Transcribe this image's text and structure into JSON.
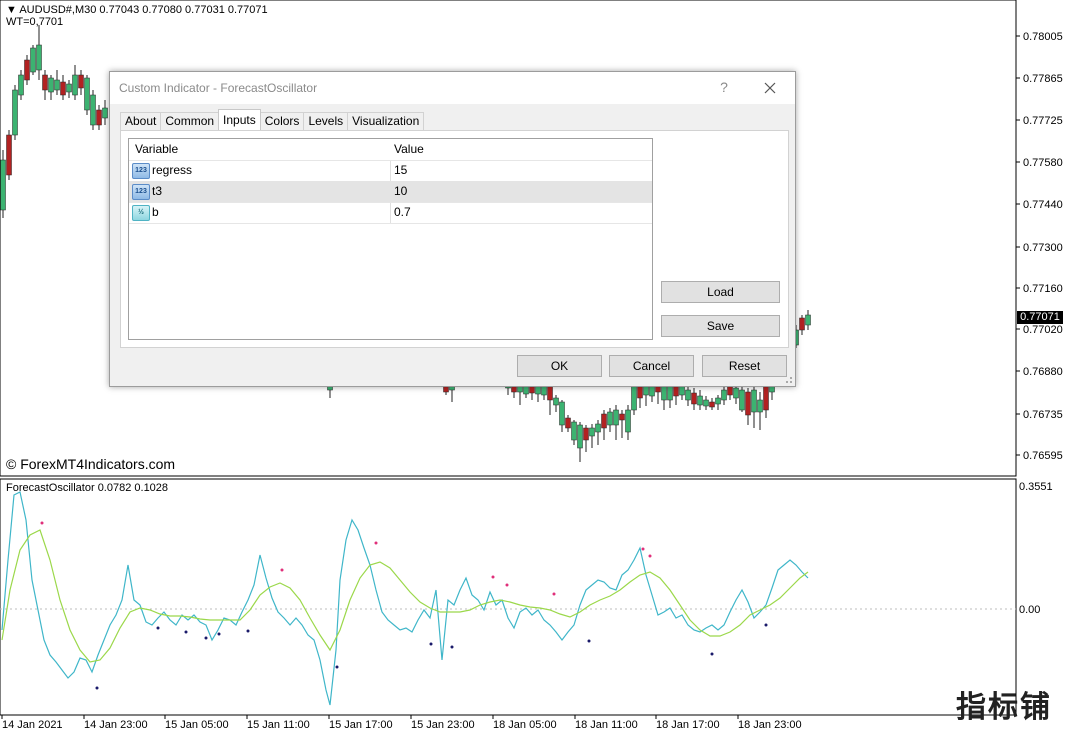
{
  "chart": {
    "symbol_line": "AUDUSD#,M30  0.77043 0.77080 0.77031 0.77071",
    "wt_line": "WT=0,7701",
    "watermark": "© ForexMT4Indicators.com",
    "current_price": "0.77071",
    "price_axis": [
      "0.78005",
      "0.77865",
      "0.77725",
      "0.77580",
      "0.77440",
      "0.77300",
      "0.77160",
      "0.77020",
      "0.76880",
      "0.76735",
      "0.76595"
    ],
    "oscillator_label": "ForecastOscillator 0.0782 0.1028",
    "oscillator_axis": [
      "0.3551",
      "0.00"
    ],
    "time_axis": [
      "14 Jan 2021",
      "14 Jan 23:00",
      "15 Jan 05:00",
      "15 Jan 11:00",
      "15 Jan 17:00",
      "15 Jan 23:00",
      "18 Jan 05:00",
      "18 Jan 11:00",
      "18 Jan 17:00",
      "18 Jan 23:00"
    ],
    "corner_logo": "指标铺",
    "colors": {
      "bull": "#3cb371",
      "bear": "#b22222",
      "osc_line": "#3fb6c9",
      "signal_line": "#9bd84a",
      "dot_top": "#e0307a",
      "dot_bottom": "#1a1a6a"
    }
  },
  "dialog": {
    "title": "Custom Indicator - ForecastOscillator",
    "help_label": "?",
    "tabs": [
      "About",
      "Common",
      "Inputs",
      "Colors",
      "Levels",
      "Visualization"
    ],
    "active_tab": "Inputs",
    "table": {
      "headers": [
        "Variable",
        "Value"
      ],
      "rows": [
        {
          "icon": "123",
          "name": "regress",
          "value": "15"
        },
        {
          "icon": "123",
          "name": "t3",
          "value": "10"
        },
        {
          "icon": "½",
          "name": "b",
          "value": "0.7"
        }
      ]
    },
    "buttons": {
      "load": "Load",
      "save": "Save",
      "ok": "OK",
      "cancel": "Cancel",
      "reset": "Reset"
    }
  }
}
